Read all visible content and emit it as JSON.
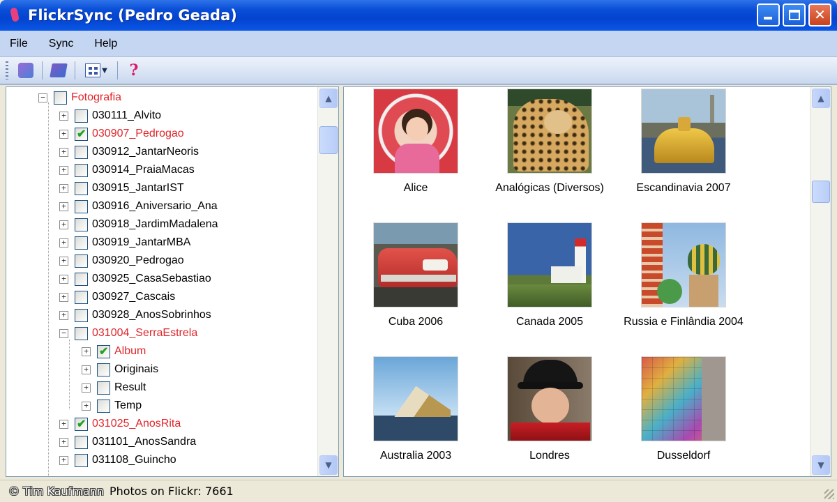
{
  "window": {
    "title": "FlickrSync (Pedro Geada)"
  },
  "menu": {
    "items": [
      "File",
      "Sync",
      "Help"
    ]
  },
  "toolbar": {
    "help_glyph": "?"
  },
  "colors": {
    "highlight_red": "#e0262b",
    "check_green": "#21a121",
    "titlebar_blue": "#0343cf"
  },
  "tree": {
    "root": "Fotografia",
    "items": [
      {
        "label": "030111_Alvito",
        "checked": false,
        "red": false
      },
      {
        "label": "030907_Pedrogao",
        "checked": true,
        "red": true
      },
      {
        "label": "030912_JantarNeoris",
        "checked": false,
        "red": false
      },
      {
        "label": "030914_PraiaMacas",
        "checked": false,
        "red": false
      },
      {
        "label": "030915_JantarIST",
        "checked": false,
        "red": false
      },
      {
        "label": "030916_Aniversario_Ana",
        "checked": false,
        "red": false
      },
      {
        "label": "030918_JardimMadalena",
        "checked": false,
        "red": false
      },
      {
        "label": "030919_JantarMBA",
        "checked": false,
        "red": false
      },
      {
        "label": "030920_Pedrogao",
        "checked": false,
        "red": false
      },
      {
        "label": "030925_CasaSebastiao",
        "checked": false,
        "red": false
      },
      {
        "label": "030927_Cascais",
        "checked": false,
        "red": false
      },
      {
        "label": "030928_AnosSobrinhos",
        "checked": false,
        "red": false
      },
      {
        "label": "031004_SerraEstrela",
        "checked": false,
        "red": true,
        "expanded": true
      },
      {
        "label": "031025_AnosRita",
        "checked": true,
        "red": true
      },
      {
        "label": "031101_AnosSandra",
        "checked": false,
        "red": false
      },
      {
        "label": "031108_Guincho",
        "checked": false,
        "red": false
      }
    ],
    "children": [
      {
        "label": "Album",
        "checked": true,
        "red": true
      },
      {
        "label": "Originais",
        "checked": false,
        "red": false
      },
      {
        "label": "Result",
        "checked": false,
        "red": false
      },
      {
        "label": "Temp",
        "checked": false,
        "red": false
      }
    ]
  },
  "albums": [
    {
      "label": "Alice"
    },
    {
      "label": "Analógicas (Diversos)"
    },
    {
      "label": "Escandinavia 2007"
    },
    {
      "label": "Cuba 2006"
    },
    {
      "label": "Canada 2005"
    },
    {
      "label": "Russia e Finlândia 2004"
    },
    {
      "label": "Australia 2003"
    },
    {
      "label": "Londres"
    },
    {
      "label": "Dusseldorf"
    }
  ],
  "status": {
    "watermark": "© Tim Kaufmann",
    "text": "Photos on Flickr: 7661"
  }
}
